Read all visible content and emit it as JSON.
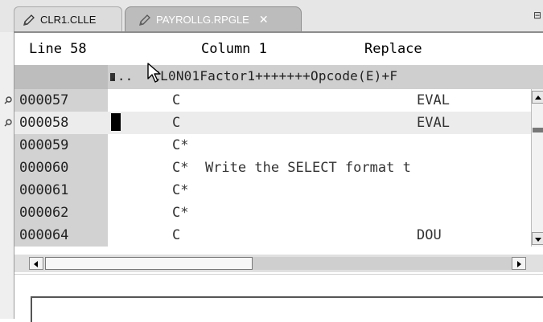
{
  "tabs": [
    {
      "label": "CLR1.CLLE",
      "icon": "pencil-icon",
      "active": false
    },
    {
      "label": "PAYROLLG.RPGLE",
      "icon": "pencil-icon",
      "active": true
    }
  ],
  "status": {
    "line_label": "Line 58",
    "column_label": "Column 1",
    "mode": "Replace"
  },
  "ruler": {
    "prefix": "...",
    "text": "CL0N01Factor1+++++++Opcode(E)+F"
  },
  "rows": [
    {
      "num": "000057",
      "spec": "C",
      "op": "EVAL",
      "breakpoint": true
    },
    {
      "num": "000058",
      "spec": "C",
      "op": "EVAL",
      "breakpoint": true
    },
    {
      "num": "000059",
      "spec": "C*",
      "op": "",
      "breakpoint": false
    },
    {
      "num": "000060",
      "spec": "C*  Write the SELECT format t",
      "op": "",
      "breakpoint": false
    },
    {
      "num": "000061",
      "spec": "C*",
      "op": "",
      "breakpoint": false
    },
    {
      "num": "000062",
      "spec": "C*",
      "op": "",
      "breakpoint": false
    },
    {
      "num": "000064",
      "spec": "C",
      "op": "DOU",
      "breakpoint": false
    }
  ],
  "window_button": "⊟"
}
